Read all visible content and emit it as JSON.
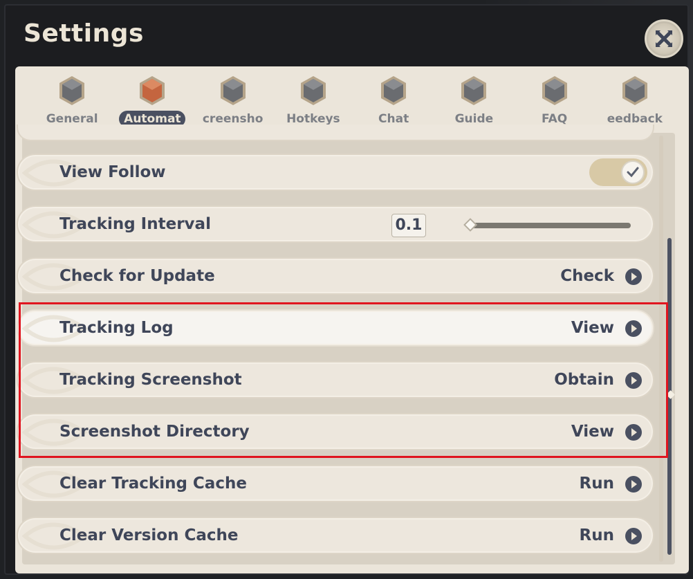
{
  "window": {
    "title": "Settings"
  },
  "tabs": [
    {
      "label": "General",
      "active": false
    },
    {
      "label": "Automat",
      "active": true
    },
    {
      "label": "creensho",
      "active": false
    },
    {
      "label": "Hotkeys",
      "active": false
    },
    {
      "label": "Chat",
      "active": false
    },
    {
      "label": "Guide",
      "active": false
    },
    {
      "label": "FAQ",
      "active": false
    },
    {
      "label": "eedback",
      "active": false
    }
  ],
  "rows": [
    {
      "label": "View Follow",
      "control": "toggle",
      "checked": true
    },
    {
      "label": "Tracking Interval",
      "control": "slider",
      "value": "0.1"
    },
    {
      "label": "Check for Update",
      "control": "action",
      "action": "Check"
    },
    {
      "label": "Tracking Log",
      "control": "action",
      "action": "View"
    },
    {
      "label": "Tracking Screenshot",
      "control": "action",
      "action": "Obtain"
    },
    {
      "label": "Screenshot Directory",
      "control": "action",
      "action": "View"
    },
    {
      "label": "Clear Tracking Cache",
      "control": "action",
      "action": "Run"
    },
    {
      "label": "Clear Version Cache",
      "control": "action",
      "action": "Run"
    }
  ],
  "colors": {
    "highlight_border": "#e0151f",
    "active_tab_bg": "#4a5061",
    "text": "#3f4659"
  },
  "icons": {
    "close": "close-icon",
    "tab": "hexagon-gem-icon",
    "action": "play-arrow-icon",
    "toggle": "checkmark-icon"
  }
}
